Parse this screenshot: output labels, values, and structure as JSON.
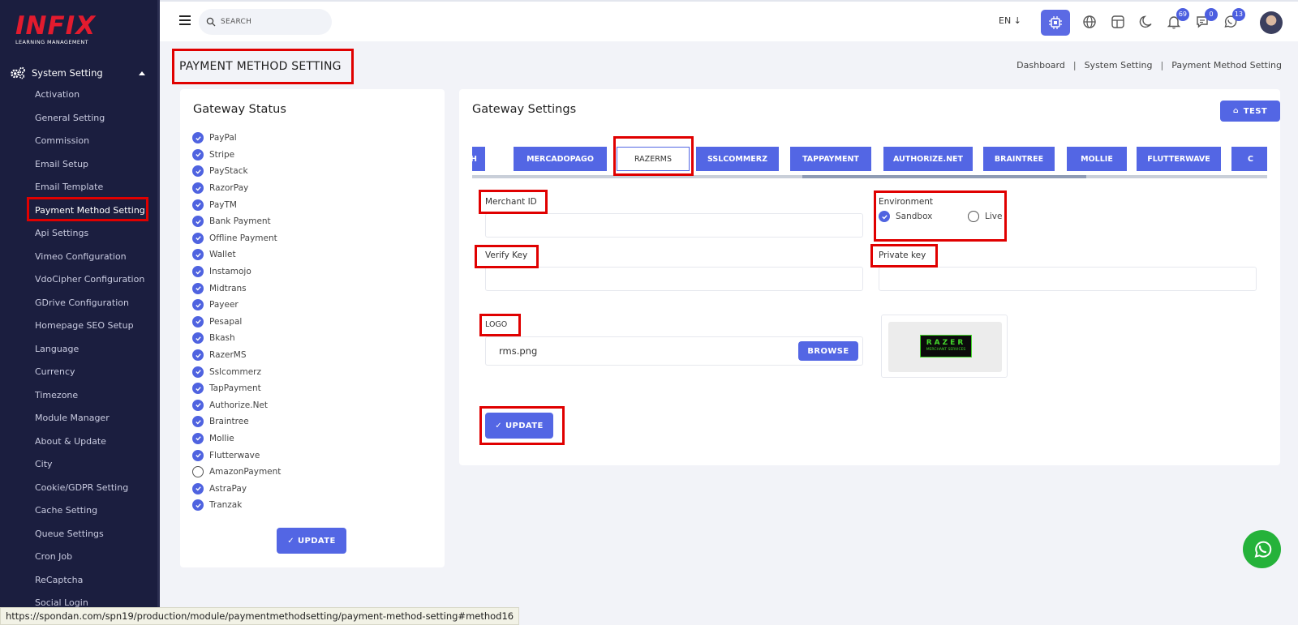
{
  "brand": {
    "name": "INFIX",
    "subtitle": "LEARNING MANAGEMENT"
  },
  "sidebar": {
    "section_label": "System Setting",
    "items": [
      {
        "label": "Activation"
      },
      {
        "label": "General Setting"
      },
      {
        "label": "Commission"
      },
      {
        "label": "Email Setup"
      },
      {
        "label": "Email Template"
      },
      {
        "label": "Payment Method Setting"
      },
      {
        "label": "Api Settings"
      },
      {
        "label": "Vimeo Configuration"
      },
      {
        "label": "VdoCipher Configuration"
      },
      {
        "label": "GDrive Configuration"
      },
      {
        "label": "Homepage SEO Setup"
      },
      {
        "label": "Language"
      },
      {
        "label": "Currency"
      },
      {
        "label": "Timezone"
      },
      {
        "label": "Module Manager"
      },
      {
        "label": "About & Update"
      },
      {
        "label": "City"
      },
      {
        "label": "Cookie/GDPR Setting"
      },
      {
        "label": "Cache Setting"
      },
      {
        "label": "Queue Settings"
      },
      {
        "label": "Cron Job"
      },
      {
        "label": "ReCaptcha"
      },
      {
        "label": "Social Login"
      }
    ],
    "active_index": 5
  },
  "topbar": {
    "search_placeholder": "SEARCH",
    "language": "EN ↓",
    "notifications_count": "69",
    "messages_count": "0",
    "whatsapp_count": "13"
  },
  "page": {
    "title": "PAYMENT METHOD SETTING",
    "breadcrumb": [
      "Dashboard",
      "System Setting",
      "Payment Method Setting"
    ]
  },
  "gateway_status": {
    "title": "Gateway Status",
    "items": [
      {
        "label": "PayPal",
        "checked": true
      },
      {
        "label": "Stripe",
        "checked": true
      },
      {
        "label": "PayStack",
        "checked": true
      },
      {
        "label": "RazorPay",
        "checked": true
      },
      {
        "label": "PayTM",
        "checked": true
      },
      {
        "label": "Bank Payment",
        "checked": true
      },
      {
        "label": "Offline Payment",
        "checked": true
      },
      {
        "label": "Wallet",
        "checked": true
      },
      {
        "label": "Instamojo",
        "checked": true
      },
      {
        "label": "Midtrans",
        "checked": true
      },
      {
        "label": "Payeer",
        "checked": true
      },
      {
        "label": "Pesapal",
        "checked": true
      },
      {
        "label": "Bkash",
        "checked": true
      },
      {
        "label": "RazerMS",
        "checked": true
      },
      {
        "label": "Sslcommerz",
        "checked": true
      },
      {
        "label": "TapPayment",
        "checked": true
      },
      {
        "label": "Authorize.Net",
        "checked": true
      },
      {
        "label": "Braintree",
        "checked": true
      },
      {
        "label": "Mollie",
        "checked": true
      },
      {
        "label": "Flutterwave",
        "checked": true
      },
      {
        "label": "AmazonPayment",
        "checked": false
      },
      {
        "label": "AstraPay",
        "checked": true
      },
      {
        "label": "Tranzak",
        "checked": true
      }
    ],
    "update_label": "✓ UPDATE"
  },
  "gateway_settings": {
    "title": "Gateway Settings",
    "test_label": "TEST",
    "tabs": [
      "ASH",
      "MERCADOPAGO",
      "RAZERMS",
      "SSLCOMMERZ",
      "TAPPAYMENT",
      "AUTHORIZE.NET",
      "BRAINTREE",
      "MOLLIE",
      "FLUTTERWAVE",
      "C"
    ],
    "active_tab": 2,
    "merchant_id_label": "Merchant ID",
    "merchant_id_value": "",
    "environment_label": "Environment",
    "env_options": [
      "Sandbox",
      "Live"
    ],
    "env_selected": "Sandbox",
    "verify_key_label": "Verify Key",
    "verify_key_value": "",
    "private_key_label": "Private key",
    "private_key_value": "",
    "logo_label": "LOGO",
    "logo_file": "rms.png",
    "browse_label": "BROWSE",
    "logo_preview": {
      "line1": "RAZER",
      "line2": "MERCHANT SERVICES"
    },
    "update_label": "✓ UPDATE"
  },
  "browser_status_url": "https://spondan.com/spn19/production/module/paymentmethodsetting/payment-method-setting#method16",
  "colors": {
    "primary": "#5366e4",
    "sidebar_bg": "#1b1e3f",
    "highlight_red": "#e00000",
    "brand_red": "#e21b2e",
    "whatsapp_green": "#25b23a"
  }
}
